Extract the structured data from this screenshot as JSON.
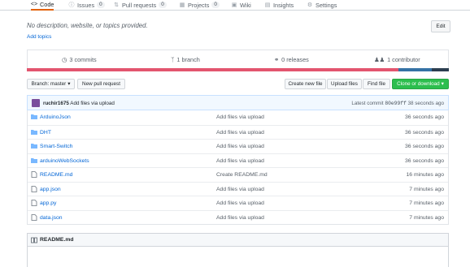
{
  "nav": {
    "tabs": [
      {
        "label": "Code",
        "icon": "code-icon"
      },
      {
        "label": "Issues",
        "count": "0",
        "icon": "issue-icon"
      },
      {
        "label": "Pull requests",
        "count": "0",
        "icon": "pull-request-icon"
      },
      {
        "label": "Projects",
        "count": "0",
        "icon": "project-icon"
      },
      {
        "label": "Wiki",
        "icon": "book-icon"
      },
      {
        "label": "Insights",
        "icon": "graph-icon"
      },
      {
        "label": "Settings",
        "icon": "gear-icon"
      }
    ]
  },
  "repo": {
    "description": "No description, website, or topics provided.",
    "add_topics": "Add topics",
    "edit_label": "Edit"
  },
  "summary": {
    "commits": "3 commits",
    "branches": "1 branch",
    "releases": "0 releases",
    "contributors": "1 contributor"
  },
  "language_bar": {
    "colors": [
      "#e3556f",
      "#3572a5",
      "#2c3e50"
    ]
  },
  "toolbar": {
    "branch_label": "Branch: master",
    "new_pr": "New pull request",
    "create_file": "Create new file",
    "upload_files": "Upload files",
    "find_file": "Find file",
    "clone": "Clone or download"
  },
  "latest_commit": {
    "author": "ruchir1675",
    "message": "Add files via upload",
    "prefix": "Latest commit",
    "sha": "80e99ff",
    "time": "38 seconds ago"
  },
  "files": [
    {
      "name": "ArduinoJson",
      "type": "folder",
      "message": "Add files via upload",
      "age": "36 seconds ago"
    },
    {
      "name": "DHT",
      "type": "folder",
      "message": "Add files via upload",
      "age": "36 seconds ago"
    },
    {
      "name": "Smart-Switch",
      "type": "folder",
      "message": "Add files via upload",
      "age": "36 seconds ago"
    },
    {
      "name": "arduinoWebSockets",
      "type": "folder",
      "message": "Add files via upload",
      "age": "36 seconds ago"
    },
    {
      "name": "README.md",
      "type": "file",
      "message": "Create README.md",
      "age": "16 minutes ago"
    },
    {
      "name": "app.json",
      "type": "file",
      "message": "Add files via upload",
      "age": "7 minutes ago"
    },
    {
      "name": "app.py",
      "type": "file",
      "message": "Add files via upload",
      "age": "7 minutes ago"
    },
    {
      "name": "data.json",
      "type": "file",
      "message": "Add files via upload",
      "age": "7 minutes ago"
    }
  ],
  "readme": {
    "title": "README.md"
  }
}
